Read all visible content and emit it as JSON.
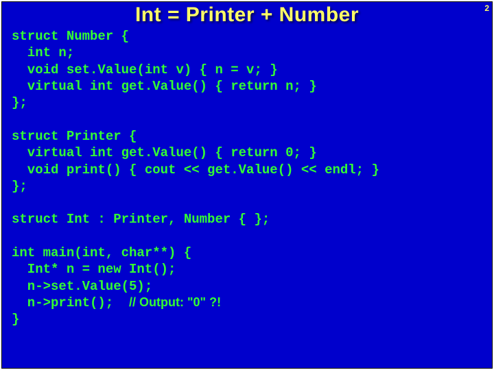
{
  "page_number": "2",
  "title": "Int = Printer + Number",
  "code": {
    "block1": "struct Number {\n  int n;\n  void set.Value(int v) { n = v; }\n  virtual int get.Value() { return n; }\n};",
    "block2": "struct Printer {\n  virtual int get.Value() { return 0; }\n  void print() { cout << get.Value() << endl; }\n};",
    "block3": "struct Int : Printer, Number { };",
    "main_l1": "int main(int, char**) {",
    "main_l2": "  Int* n = new Int();",
    "main_l3": "  n->set.Value(5);",
    "main_l4_pre": "  n->print();  ",
    "main_l4_comment": "// Output: \"0\" ?!",
    "main_l5": "}"
  }
}
